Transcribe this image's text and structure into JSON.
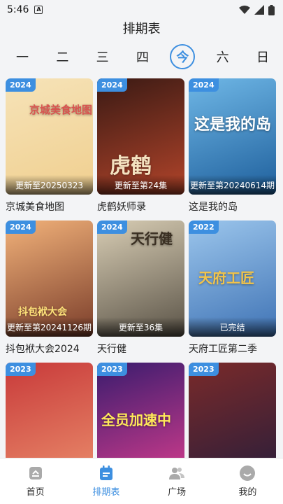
{
  "status": {
    "time": "5:46",
    "badge": "A"
  },
  "title": "排期表",
  "days": [
    "一",
    "二",
    "三",
    "四",
    "今",
    "六",
    "日"
  ],
  "active_day_index": 4,
  "cards": [
    {
      "year": "2024",
      "update": "更新至20250323",
      "name": "京城美食地图",
      "poster_text": "京城美食地图",
      "colors": [
        "#f6e3b8",
        "#f0cf8f"
      ]
    },
    {
      "year": "2024",
      "update": "更新至第24集",
      "name": "虎鹤妖师录",
      "poster_text": "虎鹤",
      "colors": [
        "#3a1a14",
        "#b2442a"
      ]
    },
    {
      "year": "2024",
      "update": "更新至第20240614期",
      "name": "这是我的岛",
      "poster_text": "这是我的岛",
      "colors": [
        "#6fb7e6",
        "#1e5f9c"
      ]
    },
    {
      "year": "2024",
      "update": "更新至第20241126期",
      "name": "抖包袱大会2024",
      "poster_text": "抖包袱大会",
      "colors": [
        "#f2b27a",
        "#7a3d2a"
      ]
    },
    {
      "year": "2024",
      "update": "更新至36集",
      "name": "天行健",
      "poster_text": "天行健",
      "colors": [
        "#d8cdb4",
        "#5a5347"
      ]
    },
    {
      "year": "2022",
      "update": "已完结",
      "name": "天府工匠第二季",
      "poster_text": "天府工匠",
      "colors": [
        "#9cc6ec",
        "#3f73b5"
      ]
    },
    {
      "year": "2023",
      "update": "",
      "name": "",
      "poster_text": "",
      "colors": [
        "#c83a3a",
        "#e98a6a"
      ]
    },
    {
      "year": "2023",
      "update": "",
      "name": "",
      "poster_text": "全员加速中",
      "colors": [
        "#3a1c6e",
        "#d13c8c"
      ]
    },
    {
      "year": "2023",
      "update": "",
      "name": "",
      "poster_text": "",
      "colors": [
        "#7a2a2a",
        "#2b1e3a"
      ]
    }
  ],
  "nav": [
    {
      "label": "首页",
      "icon": "home-icon"
    },
    {
      "label": "排期表",
      "icon": "calendar-icon"
    },
    {
      "label": "广场",
      "icon": "community-icon"
    },
    {
      "label": "我的",
      "icon": "profile-icon"
    }
  ],
  "active_nav_index": 1,
  "accent": "#3d8fe0"
}
